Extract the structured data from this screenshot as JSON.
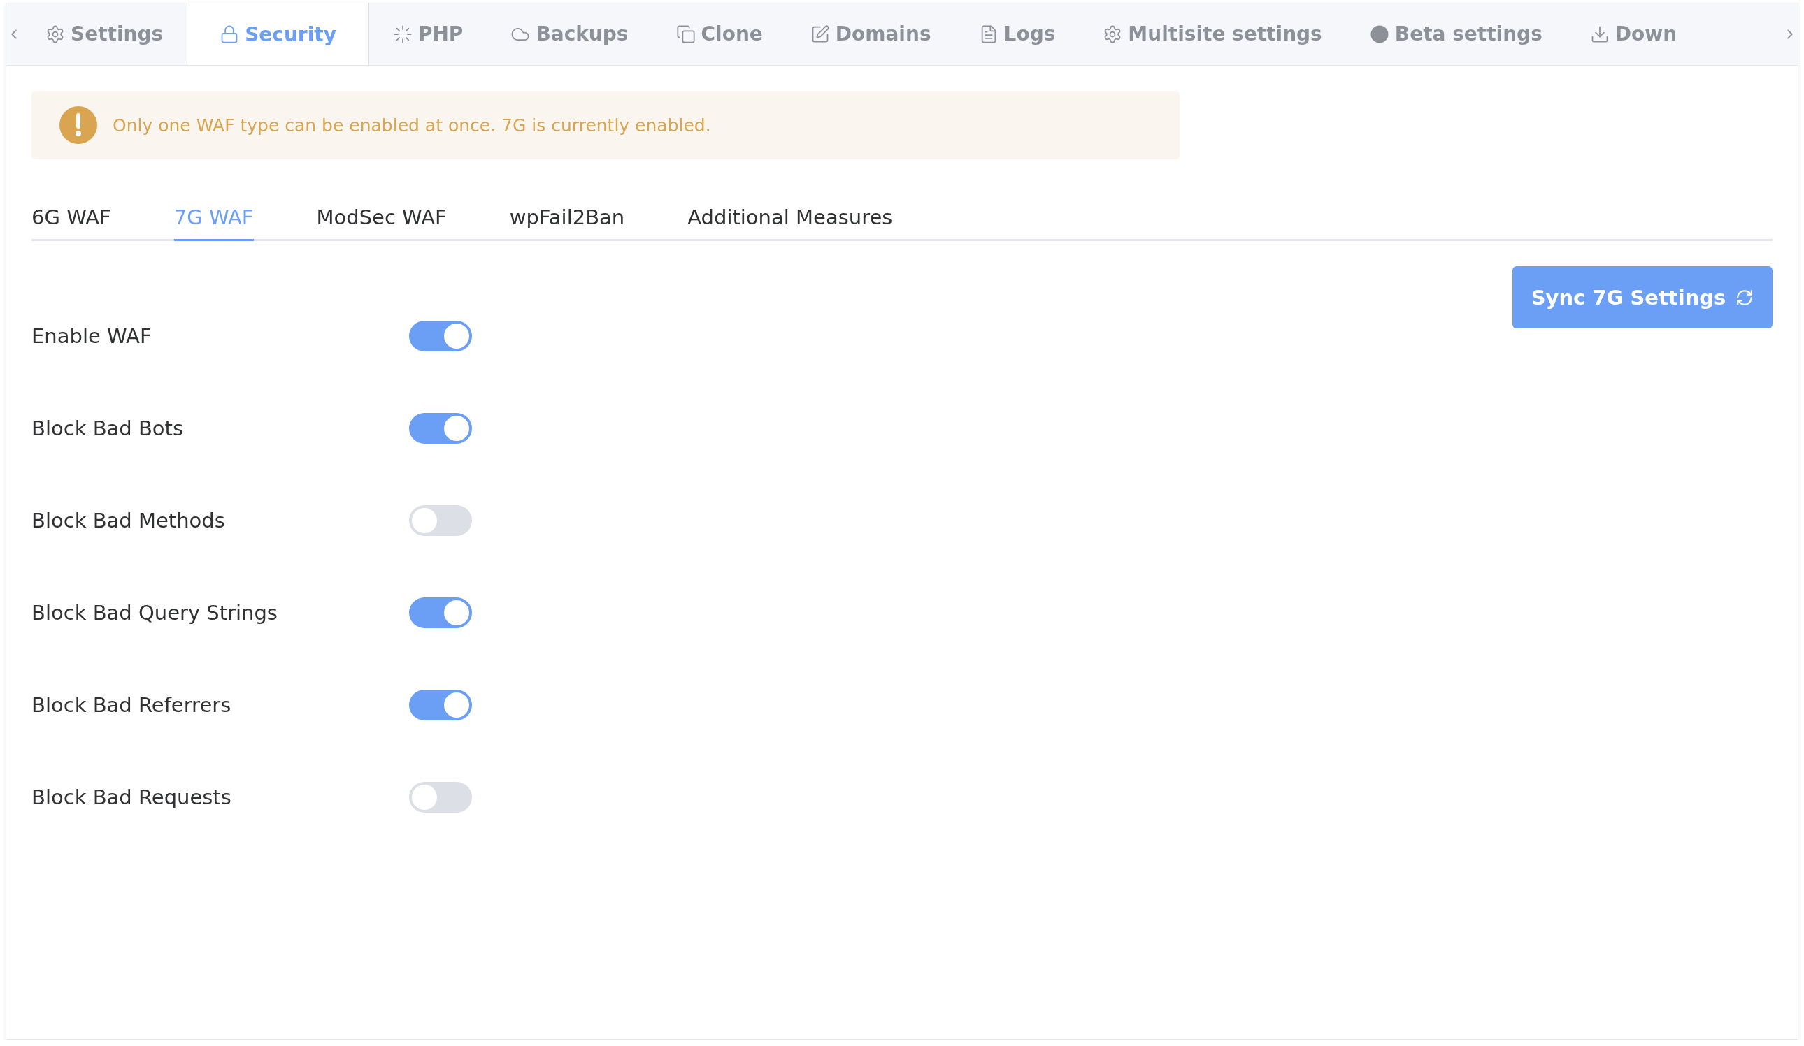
{
  "top_tabs": [
    {
      "label": "Settings",
      "selected": false
    },
    {
      "label": "Security",
      "selected": true
    },
    {
      "label": "PHP",
      "selected": false
    },
    {
      "label": "Backups",
      "selected": false
    },
    {
      "label": "Clone",
      "selected": false
    },
    {
      "label": "Domains",
      "selected": false
    },
    {
      "label": "Logs",
      "selected": false
    },
    {
      "label": "Multisite settings",
      "selected": false
    },
    {
      "label": "Beta settings",
      "selected": false
    },
    {
      "label": "Down",
      "selected": false
    }
  ],
  "alert": {
    "text": "Only one WAF type can be enabled at once. 7G is currently enabled."
  },
  "sub_tabs": [
    {
      "label": "6G WAF",
      "selected": false
    },
    {
      "label": "7G WAF",
      "selected": true
    },
    {
      "label": "ModSec WAF",
      "selected": false
    },
    {
      "label": "wpFail2Ban",
      "selected": false
    },
    {
      "label": "Additional Measures",
      "selected": false
    }
  ],
  "sync_button": {
    "label": "Sync 7G Settings"
  },
  "settings": [
    {
      "label": "Enable WAF",
      "on": true
    },
    {
      "label": "Block Bad Bots",
      "on": true
    },
    {
      "label": "Block Bad Methods",
      "on": false
    },
    {
      "label": "Block Bad Query Strings",
      "on": true
    },
    {
      "label": "Block Bad Referrers",
      "on": true
    },
    {
      "label": "Block Bad Requests",
      "on": false
    }
  ]
}
